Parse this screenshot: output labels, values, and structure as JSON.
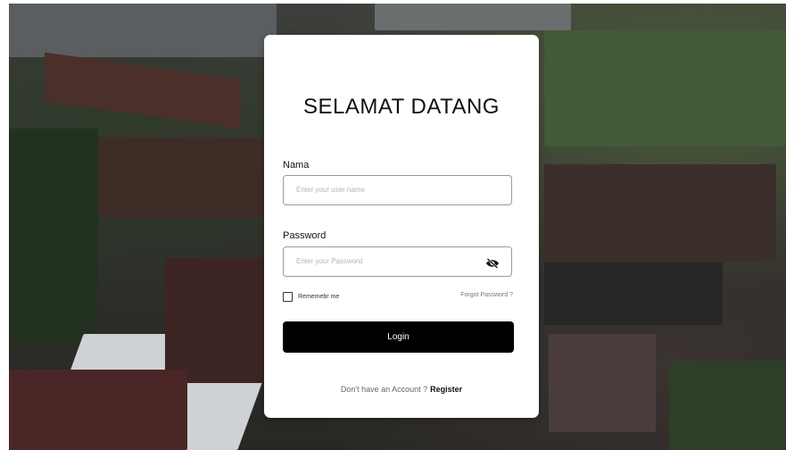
{
  "login_card": {
    "title": "SELAMAT DATANG",
    "name_label": "Nama",
    "name_placeholder": "Enter your user name",
    "password_label": "Password",
    "password_placeholder": "Enter your Password",
    "remember_label": "Rememebr me",
    "forgot_label": "Forgot Password ?",
    "login_button": "Login",
    "no_account_text": "Don't have an Account ?",
    "register_link": "Register"
  },
  "icons": {
    "password_toggle": "eye-slash-icon"
  },
  "colors": {
    "button_bg": "#000000",
    "card_bg": "#ffffff",
    "input_border": "#9a9a9a"
  }
}
